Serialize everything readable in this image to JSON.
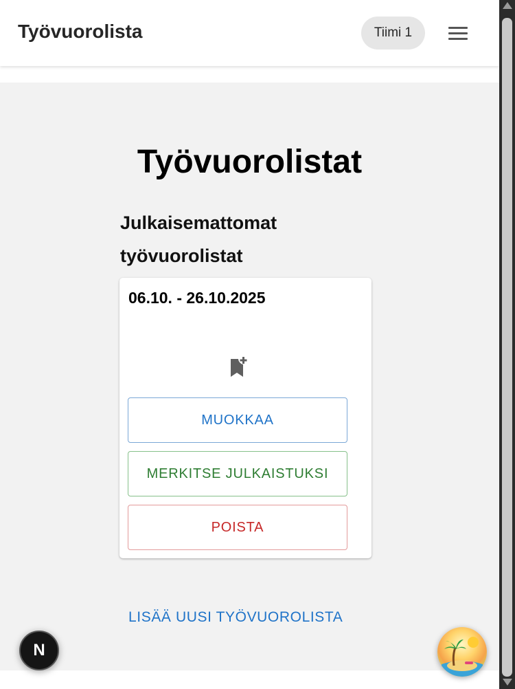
{
  "header": {
    "title": "Työvuorolista",
    "team_label": "Tiimi 1",
    "menu_icon": "hamburger-menu-icon"
  },
  "main": {
    "page_title": "Työvuorolistat",
    "unpublished_heading": "Julkaisemattomat työvuorolistat",
    "schedules": [
      {
        "date_range": "06.10. - 26.10.2025",
        "icon": "bookmark-add-icon",
        "edit_label": "MUOKKAA",
        "publish_label": "MERKITSE JULKAISTUKSI",
        "delete_label": "POISTA"
      }
    ],
    "add_new_label": "LISÄÄ UUSI TYÖVUOROLISTA"
  },
  "floating": {
    "dev_badge_letter": "N",
    "fab_icon": "beach-island-icon"
  },
  "colors": {
    "primary": "#1f73c8",
    "success": "#2e7d32",
    "danger": "#c62828",
    "background": "#f2f2f2"
  }
}
